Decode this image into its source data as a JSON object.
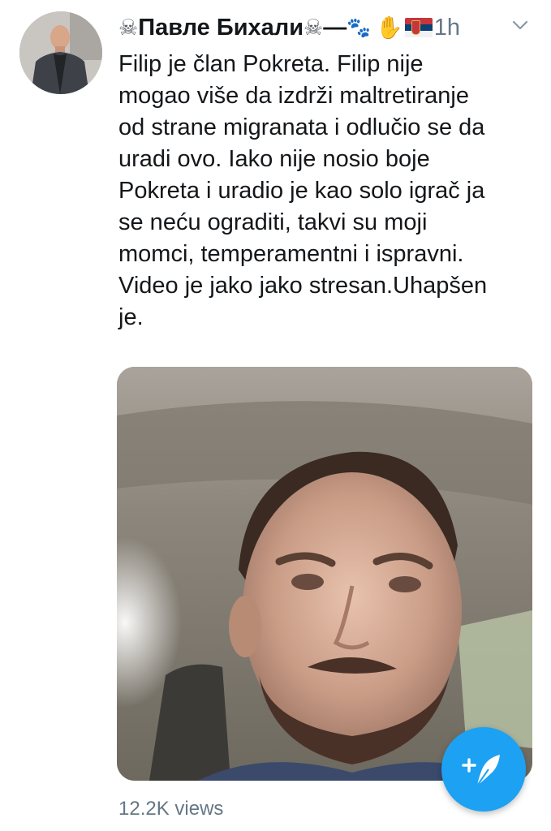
{
  "tweet": {
    "author": {
      "display_name": "Павле Бихали",
      "avatar_icon": "profile-avatar"
    },
    "time": "1h",
    "text": "Filip je član Pokreta. Filip nije\nmogao više da izdrži maltretiranje\nod strane migranata i odlučio se da\nuradi ovo. Iako nije nosio boje\nPokreta i uradio je kao solo igrač ja\nse neću ograditi, takvi su moji\nmomci, temperamentni i ispravni.\nVideo je jako jako stresan.Uhapšen\nje.",
    "views": "12.2K views",
    "name_emojis": {
      "skull": "☠",
      "dash": "—",
      "paws": "🐾",
      "hand": "✋"
    }
  },
  "icons": {
    "menu": "chevron-down-icon",
    "compose": "compose-tweet-icon",
    "flag": "serbia-flag-icon"
  },
  "colors": {
    "accent": "#1da1f2",
    "text": "#14171a",
    "muted": "#657786"
  }
}
